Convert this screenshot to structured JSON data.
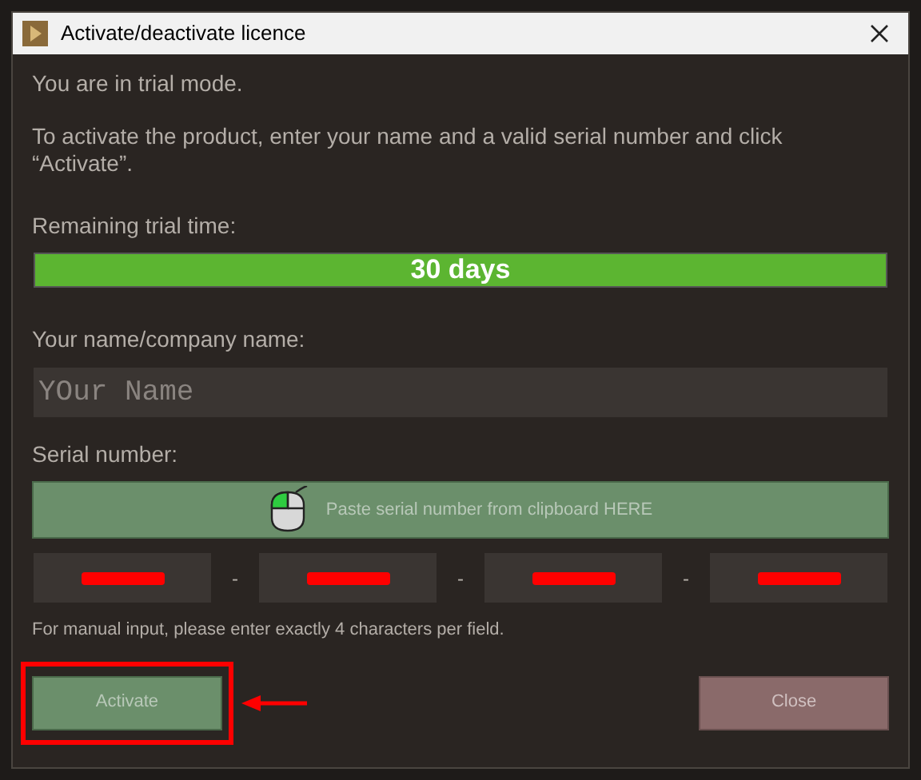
{
  "window": {
    "title": "Activate/deactivate licence"
  },
  "intro": "You are in trial mode.",
  "instructions": "To activate the product, enter your name and a valid serial number and click “Activate”.",
  "trial": {
    "label": "Remaining trial time:",
    "level": 1,
    "reading": "30 days"
  },
  "name_field": {
    "label": "Your name/company name:",
    "value": "YOur Name"
  },
  "serial": {
    "label": "Serial number:",
    "paste_button": "Paste serial number from clipboard HERE",
    "separators": [
      "-",
      "-",
      "-"
    ],
    "fields": [
      {
        "redacted": true
      },
      {
        "redacted": true
      },
      {
        "redacted": true
      },
      {
        "redacted": true
      }
    ],
    "hint": "For manual input, please enter exactly 4 characters per field."
  },
  "buttons": [
    {
      "kind": "activate",
      "label": "Activate",
      "highlighted": true
    },
    {
      "kind": "close",
      "label": "Close",
      "highlighted": false
    }
  ]
}
